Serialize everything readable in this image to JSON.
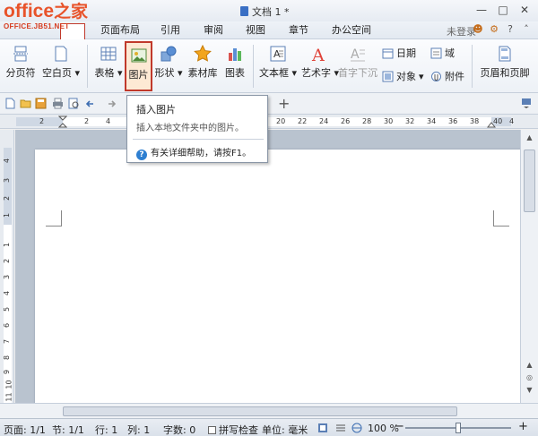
{
  "logo": {
    "brand": "office",
    "brand_zh": "之家",
    "domain": "OFFICE.JB51.NET"
  },
  "window": {
    "title": "文档 1 *",
    "controls": [
      "—",
      "□",
      "✕"
    ]
  },
  "menubar": {
    "tabs": [
      "",
      "页面布局",
      "引用",
      "审阅",
      "视图",
      "章节",
      "办公空间"
    ],
    "login": "未登录"
  },
  "ribbon": {
    "page_break": "分页符",
    "blank_page": "空白页",
    "table": "表格",
    "picture": "图片",
    "shape": "形状",
    "material": "素材库",
    "chart": "图表",
    "textbox": "文本框",
    "wordart": "艺术字",
    "dropcap": "首字下沉",
    "date": "日期",
    "field": "域",
    "object": "对象",
    "attachment": "附件",
    "header_footer": "页眉和页脚"
  },
  "tooltip": {
    "title": "插入图片",
    "description": "插入本地文件夹中的图片。",
    "help": "有关详细帮助，请按F1。"
  },
  "ruler": {
    "h_numbers": [
      "2",
      "2",
      "4",
      "6",
      "8",
      "10",
      "12",
      "14",
      "16",
      "18",
      "20",
      "22",
      "24",
      "26",
      "28",
      "30",
      "32",
      "34",
      "36",
      "38",
      "40",
      "4"
    ],
    "v_numbers": [
      "4",
      "3",
      "2",
      "1",
      "1",
      "2",
      "3",
      "4",
      "5",
      "6",
      "7",
      "8",
      "9",
      "10",
      "11"
    ],
    "corner": "L"
  },
  "status": {
    "page": "页面: 1/1",
    "section": "节: 1/1",
    "line": "行: 1",
    "column": "列: 1",
    "wordcount": "字数: 0",
    "spellcheck": "拼写检查",
    "unit": "单位: 毫米",
    "zoom": "100 %",
    "zoom_level": 0.5
  },
  "colors": {
    "accent": "#c0392b",
    "logo": "#e8532a",
    "help": "#2e7fd1"
  }
}
